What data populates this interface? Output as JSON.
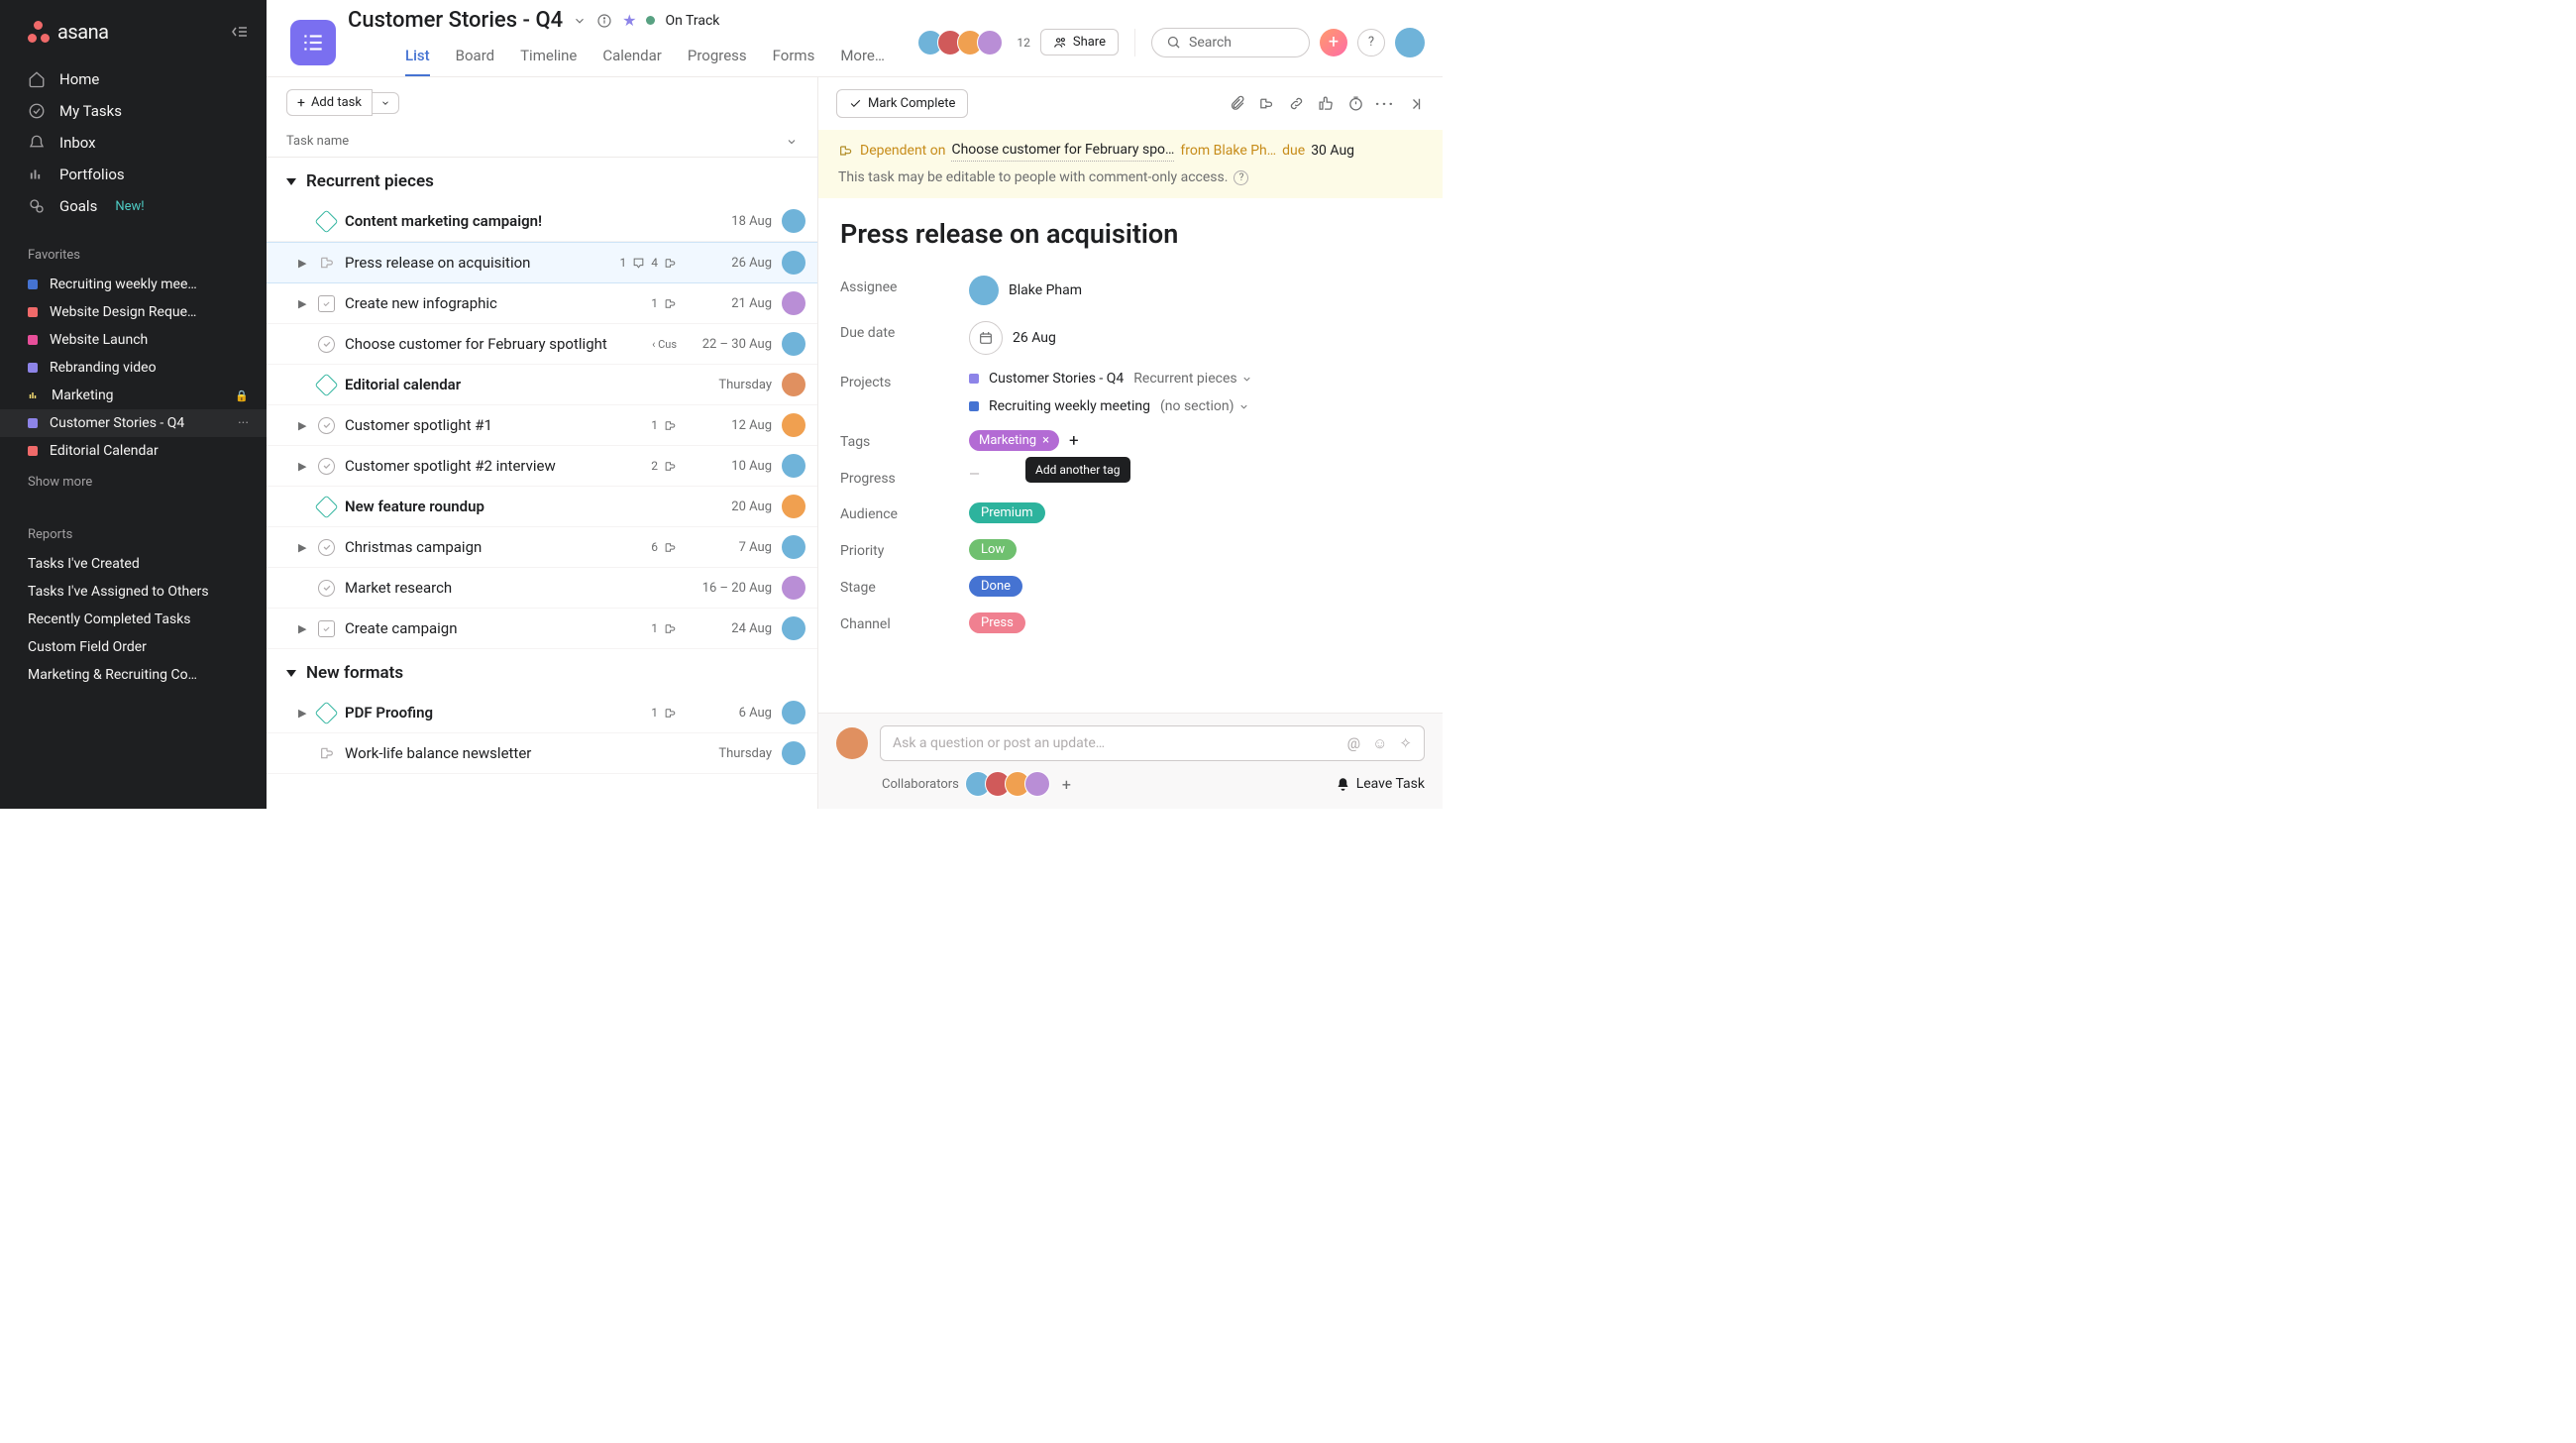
{
  "brand": "asana",
  "sidebar": {
    "nav": [
      {
        "label": "Home",
        "icon": "home-icon"
      },
      {
        "label": "My Tasks",
        "icon": "check-circle-icon"
      },
      {
        "label": "Inbox",
        "icon": "bell-icon"
      },
      {
        "label": "Portfolios",
        "icon": "bars-icon"
      },
      {
        "label": "Goals",
        "icon": "goals-icon",
        "badge": "New!"
      }
    ],
    "favorites_header": "Favorites",
    "favorites": [
      {
        "label": "Recruiting weekly mee…",
        "color": "#4573d2"
      },
      {
        "label": "Website Design Reque…",
        "color": "#f06a6a"
      },
      {
        "label": "Website Launch",
        "color": "#e84f9a"
      },
      {
        "label": "Rebranding video",
        "color": "#8d84e8"
      },
      {
        "label": "Marketing",
        "color": "#f8df72",
        "trail": "lock",
        "icon_override": "bars"
      },
      {
        "label": "Customer Stories - Q4",
        "color": "#8d84e8",
        "active": true,
        "trail": "dots"
      },
      {
        "label": "Editorial Calendar",
        "color": "#f06a6a"
      }
    ],
    "show_more": "Show more",
    "reports_header": "Reports",
    "reports": [
      "Tasks I've Created",
      "Tasks I've Assigned to Others",
      "Recently Completed Tasks",
      "Custom Field Order",
      "Marketing & Recruiting Co…"
    ]
  },
  "header": {
    "title": "Customer Stories - Q4",
    "status": "On Track",
    "member_count": "12",
    "share": "Share",
    "search_placeholder": "Search",
    "tabs": [
      "List",
      "Board",
      "Timeline",
      "Calendar",
      "Progress",
      "Forms",
      "More…"
    ],
    "active_tab": 0
  },
  "list": {
    "add_task": "Add task",
    "column_header": "Task name",
    "sections": [
      {
        "title": "Recurrent pieces",
        "tasks": [
          {
            "icon": "milestone",
            "title": "Content  marketing campaign!",
            "bold": true,
            "date": "18  Aug",
            "av": "#6fb3d9"
          },
          {
            "icon": "subtask",
            "title": "Press release on acquisition",
            "date": "26  Aug",
            "av": "#6fb3d9",
            "expand": true,
            "selected": true,
            "meta": [
              {
                "t": "1",
                "i": "comment"
              },
              {
                "t": "4",
                "i": "subtask"
              }
            ]
          },
          {
            "icon": "box",
            "title": "Create new infographic",
            "date": "21  Aug",
            "av": "#b98ed6",
            "expand": true,
            "meta": [
              {
                "t": "1",
                "i": "subtask"
              }
            ]
          },
          {
            "icon": "check",
            "title": "Choose customer for February spotlight",
            "date": "22 – 30  Aug",
            "av": "#6fb3d9",
            "tag": "‹ Cus"
          },
          {
            "icon": "milestone",
            "title": "Editorial calendar",
            "bold": true,
            "date": "Thursday",
            "av": "#e09060"
          },
          {
            "icon": "check",
            "title": "Customer spotlight #1",
            "date": "12  Aug",
            "av": "#f0a050",
            "expand": true,
            "meta": [
              {
                "t": "1",
                "i": "subtask"
              }
            ]
          },
          {
            "icon": "check",
            "title": "Customer spotlight #2 interview",
            "date": "10  Aug",
            "av": "#6fb3d9",
            "expand": true,
            "meta": [
              {
                "t": "2",
                "i": "subtask"
              }
            ]
          },
          {
            "icon": "milestone",
            "title": "New feature roundup",
            "bold": true,
            "date": "20  Aug",
            "av": "#f0a050"
          },
          {
            "icon": "check",
            "title": "Christmas campaign",
            "date": "7  Aug",
            "av": "#6fb3d9",
            "expand": true,
            "meta": [
              {
                "t": "6",
                "i": "subtask"
              }
            ]
          },
          {
            "icon": "check",
            "title": "Market research",
            "date": "16 – 20  Aug",
            "av": "#b98ed6"
          },
          {
            "icon": "box",
            "title": "Create campaign",
            "date": "24  Aug",
            "av": "#6fb3d9",
            "expand": true,
            "meta": [
              {
                "t": "1",
                "i": "subtask"
              }
            ]
          }
        ]
      },
      {
        "title": "New formats",
        "tasks": [
          {
            "icon": "milestone",
            "title": "PDF Proofing",
            "bold": true,
            "date": "6  Aug",
            "av": "#6fb3d9",
            "expand": true,
            "meta": [
              {
                "t": "1",
                "i": "subtask"
              }
            ]
          },
          {
            "icon": "subtask",
            "title": "Work-life balance newsletter",
            "date": "Thursday",
            "av": "#6fb3d9"
          }
        ]
      }
    ]
  },
  "detail": {
    "mark_complete": "Mark Complete",
    "dependency": {
      "prefix": "Dependent on",
      "task": "Choose customer for February spo…",
      "from": "from Blake Ph…",
      "due_label": "due",
      "due": "30 Aug"
    },
    "editable_note": "This task may be editable to people with comment-only access.",
    "title": "Press release on acquisition",
    "fields": {
      "assignee": {
        "label": "Assignee",
        "name": "Blake Pham",
        "av": "#6fb3d9"
      },
      "due": {
        "label": "Due date",
        "value": "26 Aug"
      },
      "projects": {
        "label": "Projects",
        "items": [
          {
            "color": "#8d84e8",
            "name": "Customer Stories - Q4",
            "section": "Recurrent pieces"
          },
          {
            "color": "#4573d2",
            "name": "Recruiting weekly meeting",
            "section": "(no section)"
          }
        ]
      },
      "tags": {
        "label": "Tags",
        "tag": "Marketing",
        "tooltip": "Add another tag"
      },
      "progress": {
        "label": "Progress"
      },
      "audience": {
        "label": "Audience",
        "value": "Premium",
        "color": "#2db39d"
      },
      "priority": {
        "label": "Priority",
        "value": "Low",
        "color": "#6fc06f"
      },
      "stage": {
        "label": "Stage",
        "value": "Done",
        "color": "#4573d2"
      },
      "channel": {
        "label": "Channel",
        "value": "Press",
        "color": "#f08090"
      }
    },
    "comment_placeholder": "Ask a question or post an update…",
    "collaborators_label": "Collaborators",
    "leave_task": "Leave Task"
  },
  "avatar_colors": [
    "#6fb3d9",
    "#d05a5a",
    "#f0a050",
    "#b98ed6"
  ]
}
